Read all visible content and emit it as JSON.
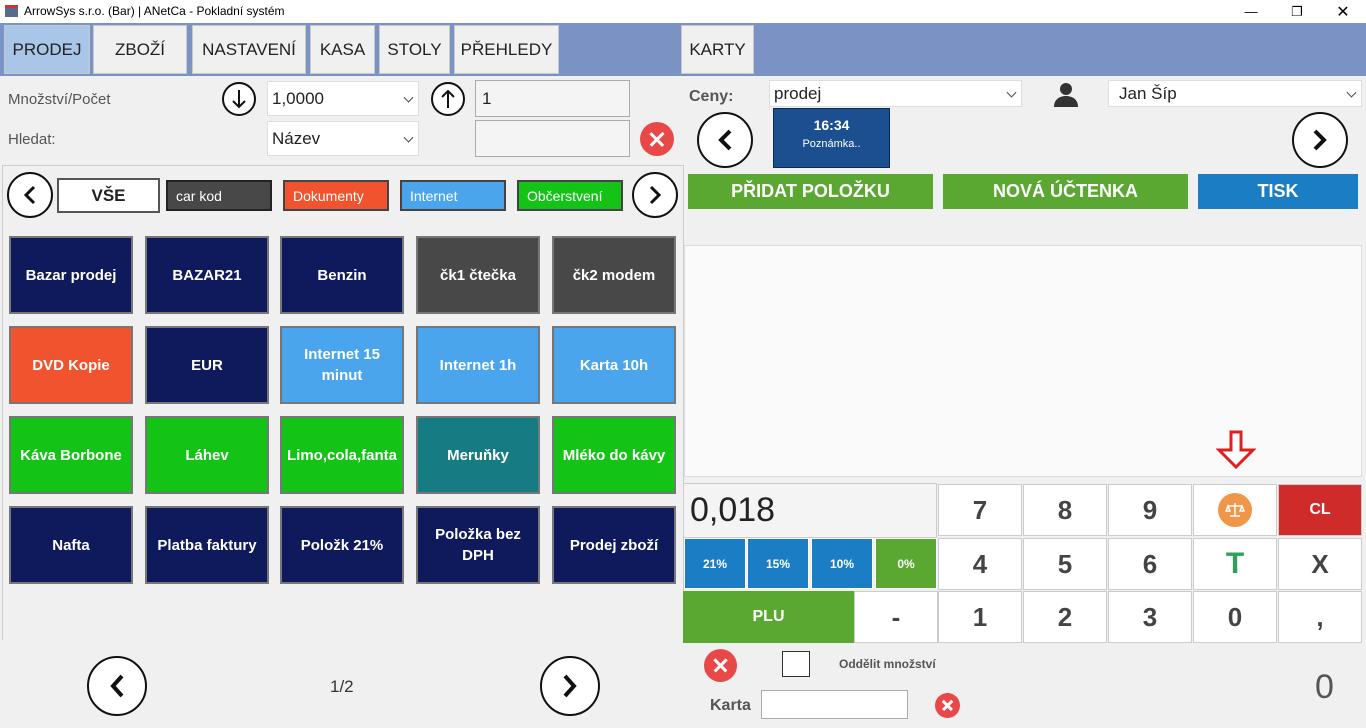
{
  "window": {
    "title": "ArrowSys s.r.o. (Bar) | ANetCa - Pokladní systém"
  },
  "tabs": [
    "PRODEJ",
    "ZBOŽÍ",
    "NASTAVENÍ",
    "KASA",
    "STOLY",
    "PŘEHLEDY",
    "KARTY"
  ],
  "left": {
    "qty_label": "Množství/Počet",
    "qty_value": "1,0000",
    "count_value": "1",
    "search_label": "Hledat:",
    "search_mode": "Název",
    "search_value": ""
  },
  "categories": [
    "VŠE",
    "car kod",
    "Dokumenty",
    "Internet",
    "Občerstvení"
  ],
  "products": [
    "Bazar prodej",
    "BAZAR21",
    "Benzin",
    "čk1 čtečka",
    "čk2 modem",
    "DVD Kopie",
    "EUR",
    "Internet 15 minut",
    "Internet 1h",
    "Karta 10h",
    "Káva Borbone",
    "Láhev",
    "Limo,cola,fanta",
    "Meruňky",
    "Mléko do kávy",
    "Nafta",
    "Platba faktury",
    "Položk 21%",
    "Položka bez DPH",
    "Prodej zboží"
  ],
  "paging": {
    "page": "1/2"
  },
  "right": {
    "prices_label": "Ceny:",
    "prices_value": "prodej",
    "user": "Jan  Šíp",
    "time": "16:34",
    "note": "Poznámka..",
    "add_item": "PŘIDAT POLOŽKU",
    "new_receipt": "NOVÁ ÚČTENKA",
    "print": "TISK"
  },
  "keypad": {
    "display": "0,018",
    "vat": [
      "21%",
      "15%",
      "10%",
      "0%"
    ],
    "plu": "PLU",
    "keys": [
      "7",
      "8",
      "9",
      "4",
      "5",
      "6",
      "-",
      "1",
      "2",
      "3",
      "0",
      ",",
      "CL",
      "T",
      "X"
    ]
  },
  "bottom": {
    "split_label": "Oddělit množství",
    "card_label": "Karta",
    "card_value": "",
    "total": "0"
  },
  "colors": {
    "nav": "#7b93c4",
    "active_tab": "#a9c6e8",
    "green": "#5aa832",
    "blue": "#1b7ec4",
    "red": "#cf2b2b"
  }
}
